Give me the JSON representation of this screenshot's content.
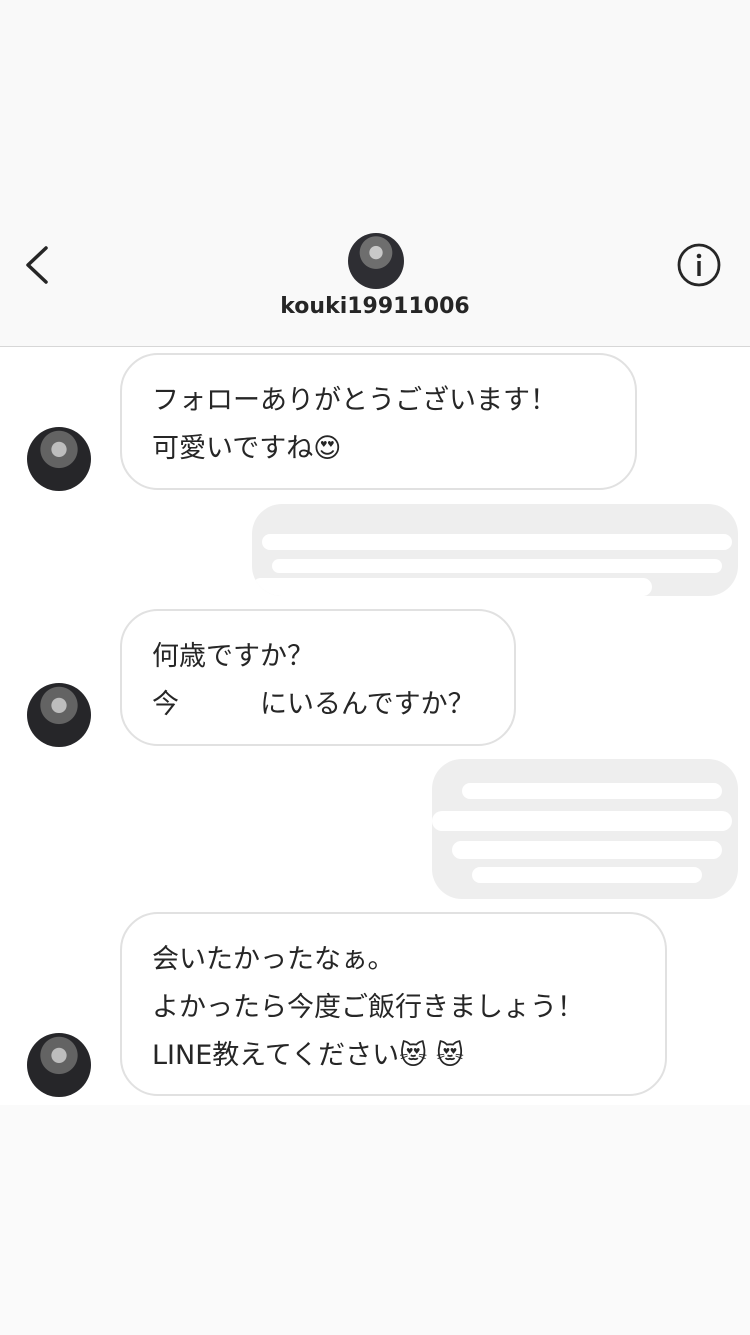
{
  "header": {
    "username": "kouki19911006",
    "back_icon": "chevron-left-icon",
    "info_icon": "info-circle-icon"
  },
  "messages": [
    {
      "text": "フォローありがとうございます！\n可愛いですね😍"
    },
    {
      "text": "何歳ですか？\n今　　　にいるんですか？"
    },
    {
      "text": "会いたかったなぁ。\nよかったら今度ご飯行きましょう！\nLINE教えてください😻 😻"
    }
  ]
}
